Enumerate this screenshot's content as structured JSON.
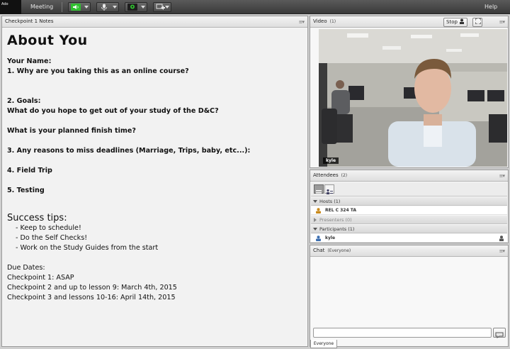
{
  "topbar": {
    "logo_text": "Ado",
    "menu_meeting": "Meeting",
    "menu_help": "Help"
  },
  "notes_pod": {
    "title": "Checkpoint 1 Notes",
    "heading": "About You",
    "lines": [
      "Your Name:",
      "1. Why are you taking this as an online course?",
      "2. Goals:",
      "What do you hope to get out of your study of the D&C?",
      "What is your planned finish time?",
      "3. Any reasons to miss deadlines (Marriage, Trips, baby, etc...):",
      "4. Field Trip",
      "5. Testing"
    ],
    "tips_heading": "Success tips:",
    "tips": [
      "- Keep to schedule!",
      "- Do the Self Checks!",
      "- Work on the Study Guides from the start"
    ],
    "due_heading": "Due Dates:",
    "due": [
      "Checkpoint 1: ASAP",
      "Checkpoint 2 and up to lesson 9: March 4th, 2015",
      "Checkpoint 3 and lessons 10-16: April 14th, 2015"
    ]
  },
  "video_pod": {
    "title": "Video",
    "count": "(1)",
    "stop_label": "Stop",
    "presenter_name": "kyle"
  },
  "attendees_pod": {
    "title": "Attendees",
    "count": "(2)",
    "hosts_label": "Hosts (1)",
    "host_name": "REL C 324 TA",
    "presenters_label": "Presenters (0)",
    "participants_label": "Participants (1)",
    "participant_name": "kyle"
  },
  "chat_pod": {
    "title": "Chat",
    "scope": "(Everyone)",
    "tab_label": "Everyone",
    "input_value": ""
  },
  "colors": {
    "speaker_green": "#2fbf2f",
    "header_gray": "#dedede",
    "topbar": "#3a3a3a"
  },
  "icons": [
    "speaker-icon",
    "microphone-icon",
    "webcam-icon",
    "share-screen-icon",
    "stop-icon",
    "fullscreen-icon",
    "grid-view-icon",
    "list-view-icon",
    "user-icon",
    "chat-send-icon"
  ]
}
